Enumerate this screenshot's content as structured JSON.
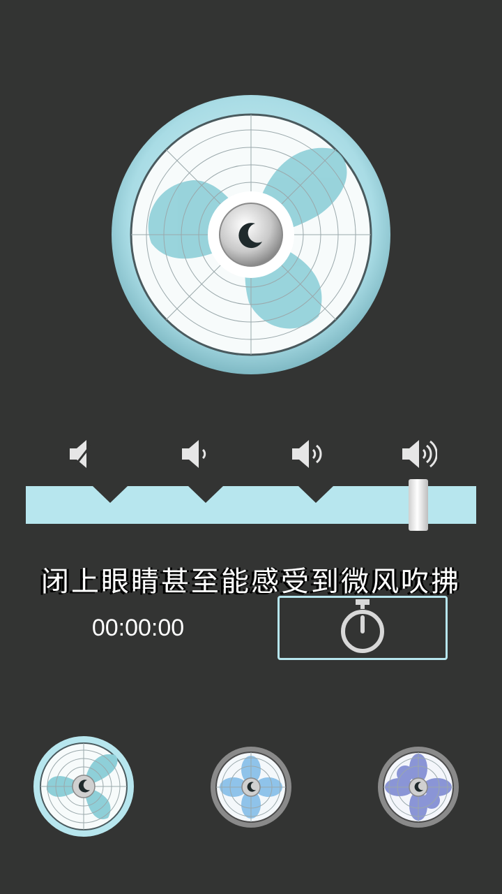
{
  "tagline": "闭上眼睛甚至能感受到微风吹拂",
  "timer": {
    "display": "00:00:00"
  },
  "speed": {
    "levels": 4,
    "selected_level": 4
  },
  "icons": {
    "main_center": "moon-icon",
    "speed_levels": [
      "volume-mute-icon",
      "volume-low-icon",
      "volume-medium-icon",
      "volume-high-icon"
    ],
    "timer": "stopwatch-icon"
  },
  "fan_styles": [
    {
      "name": "fan-style-teal",
      "selected": true
    },
    {
      "name": "fan-style-blue",
      "selected": false
    },
    {
      "name": "fan-style-purple",
      "selected": false
    }
  ],
  "colors": {
    "background": "#333433",
    "accent": "#b7e6ee",
    "fan_blade": "#8ecfd8",
    "thumb_blue": "#8fc3ea",
    "thumb_purple": "#8a95d6"
  }
}
